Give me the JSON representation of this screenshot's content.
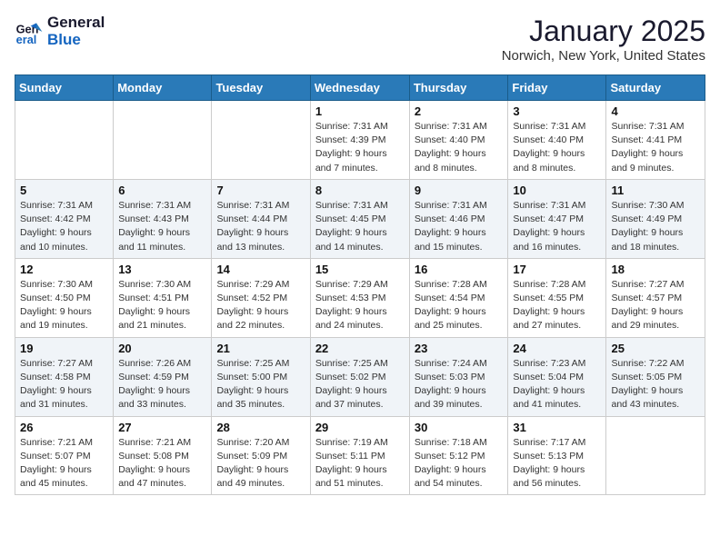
{
  "header": {
    "logo_line1": "General",
    "logo_line2": "Blue",
    "month_title": "January 2025",
    "location": "Norwich, New York, United States"
  },
  "weekdays": [
    "Sunday",
    "Monday",
    "Tuesday",
    "Wednesday",
    "Thursday",
    "Friday",
    "Saturday"
  ],
  "weeks": [
    [
      {
        "day": "",
        "info": ""
      },
      {
        "day": "",
        "info": ""
      },
      {
        "day": "",
        "info": ""
      },
      {
        "day": "1",
        "info": "Sunrise: 7:31 AM\nSunset: 4:39 PM\nDaylight: 9 hours\nand 7 minutes."
      },
      {
        "day": "2",
        "info": "Sunrise: 7:31 AM\nSunset: 4:40 PM\nDaylight: 9 hours\nand 8 minutes."
      },
      {
        "day": "3",
        "info": "Sunrise: 7:31 AM\nSunset: 4:40 PM\nDaylight: 9 hours\nand 8 minutes."
      },
      {
        "day": "4",
        "info": "Sunrise: 7:31 AM\nSunset: 4:41 PM\nDaylight: 9 hours\nand 9 minutes."
      }
    ],
    [
      {
        "day": "5",
        "info": "Sunrise: 7:31 AM\nSunset: 4:42 PM\nDaylight: 9 hours\nand 10 minutes."
      },
      {
        "day": "6",
        "info": "Sunrise: 7:31 AM\nSunset: 4:43 PM\nDaylight: 9 hours\nand 11 minutes."
      },
      {
        "day": "7",
        "info": "Sunrise: 7:31 AM\nSunset: 4:44 PM\nDaylight: 9 hours\nand 13 minutes."
      },
      {
        "day": "8",
        "info": "Sunrise: 7:31 AM\nSunset: 4:45 PM\nDaylight: 9 hours\nand 14 minutes."
      },
      {
        "day": "9",
        "info": "Sunrise: 7:31 AM\nSunset: 4:46 PM\nDaylight: 9 hours\nand 15 minutes."
      },
      {
        "day": "10",
        "info": "Sunrise: 7:31 AM\nSunset: 4:47 PM\nDaylight: 9 hours\nand 16 minutes."
      },
      {
        "day": "11",
        "info": "Sunrise: 7:30 AM\nSunset: 4:49 PM\nDaylight: 9 hours\nand 18 minutes."
      }
    ],
    [
      {
        "day": "12",
        "info": "Sunrise: 7:30 AM\nSunset: 4:50 PM\nDaylight: 9 hours\nand 19 minutes."
      },
      {
        "day": "13",
        "info": "Sunrise: 7:30 AM\nSunset: 4:51 PM\nDaylight: 9 hours\nand 21 minutes."
      },
      {
        "day": "14",
        "info": "Sunrise: 7:29 AM\nSunset: 4:52 PM\nDaylight: 9 hours\nand 22 minutes."
      },
      {
        "day": "15",
        "info": "Sunrise: 7:29 AM\nSunset: 4:53 PM\nDaylight: 9 hours\nand 24 minutes."
      },
      {
        "day": "16",
        "info": "Sunrise: 7:28 AM\nSunset: 4:54 PM\nDaylight: 9 hours\nand 25 minutes."
      },
      {
        "day": "17",
        "info": "Sunrise: 7:28 AM\nSunset: 4:55 PM\nDaylight: 9 hours\nand 27 minutes."
      },
      {
        "day": "18",
        "info": "Sunrise: 7:27 AM\nSunset: 4:57 PM\nDaylight: 9 hours\nand 29 minutes."
      }
    ],
    [
      {
        "day": "19",
        "info": "Sunrise: 7:27 AM\nSunset: 4:58 PM\nDaylight: 9 hours\nand 31 minutes."
      },
      {
        "day": "20",
        "info": "Sunrise: 7:26 AM\nSunset: 4:59 PM\nDaylight: 9 hours\nand 33 minutes."
      },
      {
        "day": "21",
        "info": "Sunrise: 7:25 AM\nSunset: 5:00 PM\nDaylight: 9 hours\nand 35 minutes."
      },
      {
        "day": "22",
        "info": "Sunrise: 7:25 AM\nSunset: 5:02 PM\nDaylight: 9 hours\nand 37 minutes."
      },
      {
        "day": "23",
        "info": "Sunrise: 7:24 AM\nSunset: 5:03 PM\nDaylight: 9 hours\nand 39 minutes."
      },
      {
        "day": "24",
        "info": "Sunrise: 7:23 AM\nSunset: 5:04 PM\nDaylight: 9 hours\nand 41 minutes."
      },
      {
        "day": "25",
        "info": "Sunrise: 7:22 AM\nSunset: 5:05 PM\nDaylight: 9 hours\nand 43 minutes."
      }
    ],
    [
      {
        "day": "26",
        "info": "Sunrise: 7:21 AM\nSunset: 5:07 PM\nDaylight: 9 hours\nand 45 minutes."
      },
      {
        "day": "27",
        "info": "Sunrise: 7:21 AM\nSunset: 5:08 PM\nDaylight: 9 hours\nand 47 minutes."
      },
      {
        "day": "28",
        "info": "Sunrise: 7:20 AM\nSunset: 5:09 PM\nDaylight: 9 hours\nand 49 minutes."
      },
      {
        "day": "29",
        "info": "Sunrise: 7:19 AM\nSunset: 5:11 PM\nDaylight: 9 hours\nand 51 minutes."
      },
      {
        "day": "30",
        "info": "Sunrise: 7:18 AM\nSunset: 5:12 PM\nDaylight: 9 hours\nand 54 minutes."
      },
      {
        "day": "31",
        "info": "Sunrise: 7:17 AM\nSunset: 5:13 PM\nDaylight: 9 hours\nand 56 minutes."
      },
      {
        "day": "",
        "info": ""
      }
    ]
  ]
}
